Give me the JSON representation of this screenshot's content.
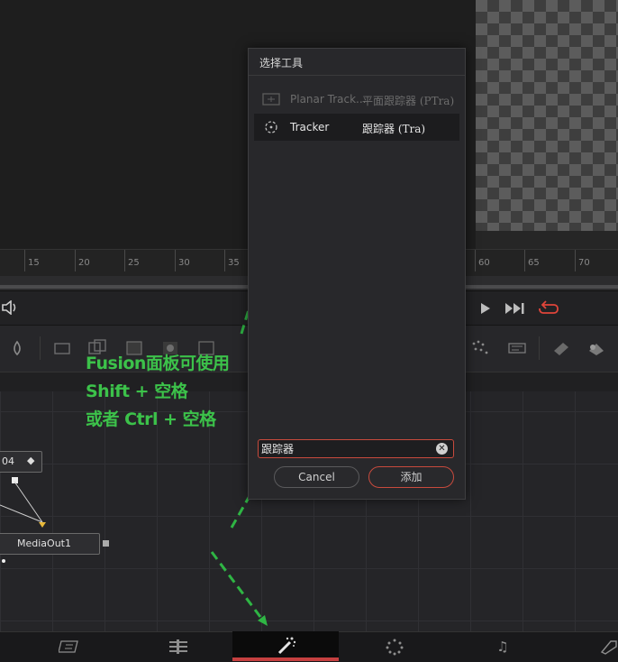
{
  "dialog": {
    "title": "选择工具",
    "items": [
      {
        "name": "Planar Track...",
        "zh": "平面跟踪器 (PTra)",
        "icon": "planar-tracker-icon",
        "state": "dimmed"
      },
      {
        "name": "Tracker",
        "zh": "跟踪器 (Tra)",
        "icon": "tracker-icon",
        "state": "selected"
      }
    ],
    "search_value": "跟踪器",
    "cancel_label": "Cancel",
    "add_label": "添加"
  },
  "ruler": {
    "ticks": [
      "15",
      "20",
      "25",
      "30",
      "35",
      "60",
      "65",
      "70"
    ]
  },
  "nodes": {
    "upper_label": "04",
    "media_out_label": "MediaOut1"
  },
  "annotation": {
    "lines": [
      "Fusion面板可使用",
      "Shift + 空格",
      "或者 Ctrl + 空格"
    ],
    "color": "#3cc24a"
  },
  "colors": {
    "accent_red": "#c84a3d",
    "annotation_green": "#3cc24a"
  }
}
